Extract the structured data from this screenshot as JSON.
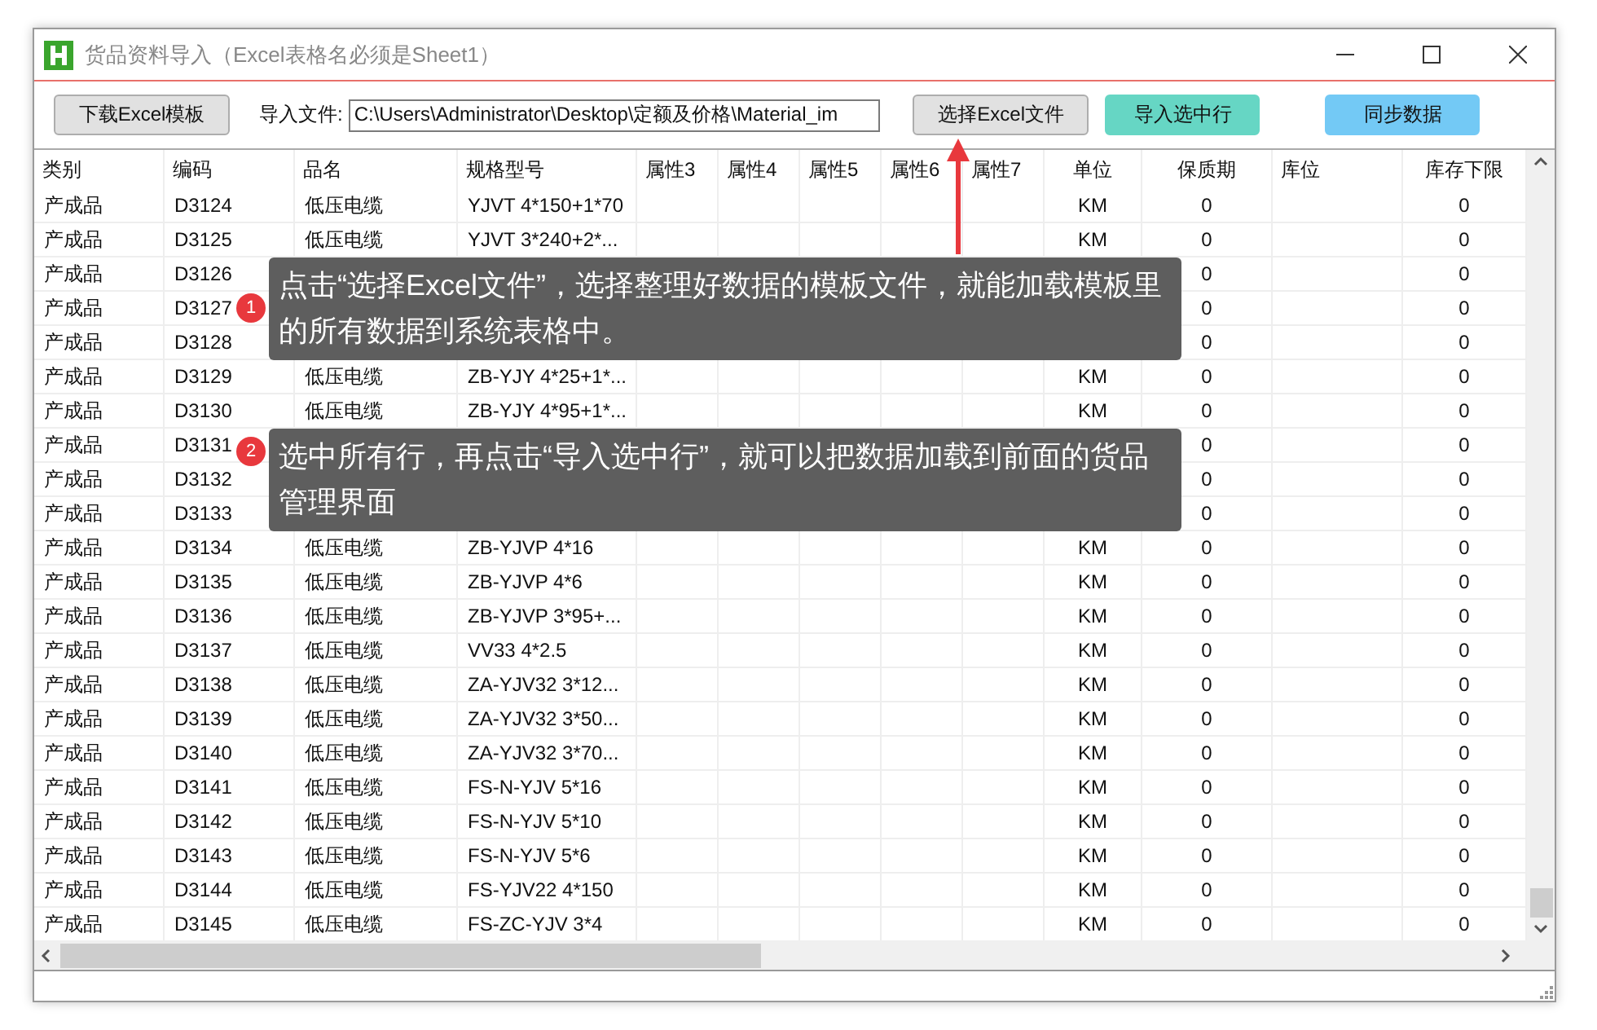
{
  "window": {
    "title": "货品资料导入（Excel表格名必须是Sheet1）"
  },
  "toolbar": {
    "download_button": "下载Excel模板",
    "file_label": "导入文件:",
    "file_path": "C:\\Users\\Administrator\\Desktop\\定额及价格\\Material_im",
    "select_button": "选择Excel文件",
    "import_button": "导入选中行",
    "sync_button": "同步数据"
  },
  "table": {
    "columns": [
      "类别",
      "编码",
      "品名",
      "规格型号",
      "属性3",
      "属性4",
      "属性5",
      "属性6",
      "属性7",
      "单位",
      "保质期",
      "库位",
      "库存下限"
    ],
    "rows": [
      {
        "category": "产成品",
        "code": "D3124",
        "name": "低压电缆",
        "spec": "YJVT 4*150+1*70",
        "unit": "KM",
        "shelf_life": "0",
        "min_stock": "0"
      },
      {
        "category": "产成品",
        "code": "D3125",
        "name": "低压电缆",
        "spec": "YJVT 3*240+2*...",
        "unit": "KM",
        "shelf_life": "0",
        "min_stock": "0"
      },
      {
        "category": "产成品",
        "code": "D3126",
        "shelf_life": "0",
        "min_stock": "0"
      },
      {
        "category": "产成品",
        "code": "D3127",
        "shelf_life": "0",
        "min_stock": "0"
      },
      {
        "category": "产成品",
        "code": "D3128",
        "shelf_life": "0",
        "min_stock": "0"
      },
      {
        "category": "产成品",
        "code": "D3129",
        "name": "低压电缆",
        "spec": "ZB-YJY 4*25+1*...",
        "unit": "KM",
        "shelf_life": "0",
        "min_stock": "0"
      },
      {
        "category": "产成品",
        "code": "D3130",
        "name": "低压电缆",
        "spec": "ZB-YJY 4*95+1*...",
        "unit": "KM",
        "shelf_life": "0",
        "min_stock": "0"
      },
      {
        "category": "产成品",
        "code": "D3131",
        "shelf_life": "0",
        "min_stock": "0"
      },
      {
        "category": "产成品",
        "code": "D3132",
        "shelf_life": "0",
        "min_stock": "0"
      },
      {
        "category": "产成品",
        "code": "D3133",
        "shelf_life": "0",
        "min_stock": "0"
      },
      {
        "category": "产成品",
        "code": "D3134",
        "name": "低压电缆",
        "spec": "ZB-YJVP 4*16",
        "unit": "KM",
        "shelf_life": "0",
        "min_stock": "0"
      },
      {
        "category": "产成品",
        "code": "D3135",
        "name": "低压电缆",
        "spec": "ZB-YJVP 4*6",
        "unit": "KM",
        "shelf_life": "0",
        "min_stock": "0"
      },
      {
        "category": "产成品",
        "code": "D3136",
        "name": "低压电缆",
        "spec": "ZB-YJVP 3*95+...",
        "unit": "KM",
        "shelf_life": "0",
        "min_stock": "0"
      },
      {
        "category": "产成品",
        "code": "D3137",
        "name": "低压电缆",
        "spec": "VV33 4*2.5",
        "unit": "KM",
        "shelf_life": "0",
        "min_stock": "0"
      },
      {
        "category": "产成品",
        "code": "D3138",
        "name": "低压电缆",
        "spec": "ZA-YJV32 3*12...",
        "unit": "KM",
        "shelf_life": "0",
        "min_stock": "0"
      },
      {
        "category": "产成品",
        "code": "D3139",
        "name": "低压电缆",
        "spec": "ZA-YJV32 3*50...",
        "unit": "KM",
        "shelf_life": "0",
        "min_stock": "0"
      },
      {
        "category": "产成品",
        "code": "D3140",
        "name": "低压电缆",
        "spec": "ZA-YJV32 3*70...",
        "unit": "KM",
        "shelf_life": "0",
        "min_stock": "0"
      },
      {
        "category": "产成品",
        "code": "D3141",
        "name": "低压电缆",
        "spec": "FS-N-YJV 5*16",
        "unit": "KM",
        "shelf_life": "0",
        "min_stock": "0"
      },
      {
        "category": "产成品",
        "code": "D3142",
        "name": "低压电缆",
        "spec": "FS-N-YJV 5*10",
        "unit": "KM",
        "shelf_life": "0",
        "min_stock": "0"
      },
      {
        "category": "产成品",
        "code": "D3143",
        "name": "低压电缆",
        "spec": "FS-N-YJV 5*6",
        "unit": "KM",
        "shelf_life": "0",
        "min_stock": "0"
      },
      {
        "category": "产成品",
        "code": "D3144",
        "name": "低压电缆",
        "spec": "FS-YJV22 4*150",
        "unit": "KM",
        "shelf_life": "0",
        "min_stock": "0"
      },
      {
        "category": "产成品",
        "code": "D3145",
        "name": "低压电缆",
        "spec": "FS-ZC-YJV 3*4",
        "unit": "KM",
        "shelf_life": "0",
        "min_stock": "0"
      }
    ]
  },
  "callouts": [
    {
      "number": "1",
      "text": "点击“选择Excel文件”，选择整理好数据的模板文件，就能加载模板里的所有数据到系统表格中。"
    },
    {
      "number": "2",
      "text": "选中所有行，再点击“导入选中行”，就可以把数据加载到前面的货品管理界面"
    }
  ]
}
